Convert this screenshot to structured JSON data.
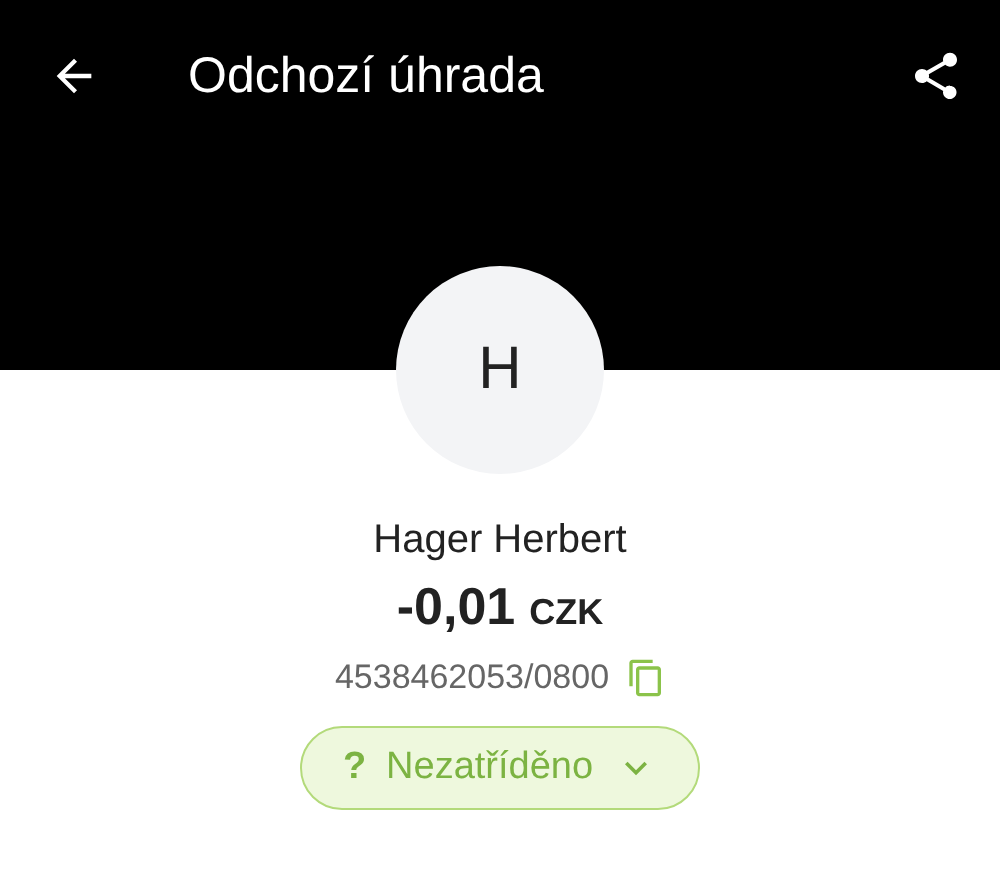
{
  "app_bar": {
    "title": "Odchozí úhrada"
  },
  "avatar": {
    "initial": "H"
  },
  "payee": {
    "name": "Hager Herbert",
    "amount": "-0,01",
    "currency": "CZK",
    "account": "4538462053/0800"
  },
  "category": {
    "symbol": "?",
    "label": "Nezatříděno"
  }
}
